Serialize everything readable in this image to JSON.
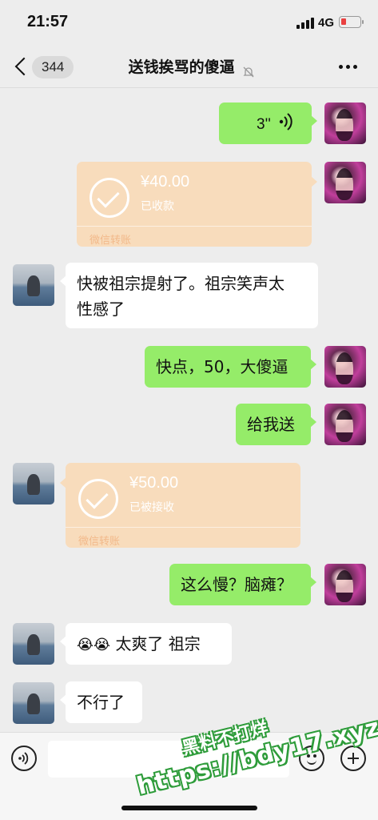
{
  "status_bar": {
    "time": "21:57",
    "network": "4G"
  },
  "nav": {
    "back_badge": "344",
    "title": "送钱挨骂的傻逼"
  },
  "messages": [
    {
      "side": "right",
      "type": "voice",
      "duration": "3''"
    },
    {
      "side": "right",
      "type": "transfer",
      "amount": "¥40.00",
      "status": "已收款",
      "footer": "微信转账"
    },
    {
      "side": "left",
      "type": "text",
      "line1": "快被祖宗提射了。祖宗笑声太",
      "line2": "性感了"
    },
    {
      "side": "right",
      "type": "text",
      "text": "快点，50，大傻逼"
    },
    {
      "side": "right",
      "type": "text",
      "text": "给我送"
    },
    {
      "side": "left",
      "type": "transfer",
      "amount": "¥50.00",
      "status": "已被接收",
      "footer": "微信转账"
    },
    {
      "side": "right",
      "type": "text",
      "text": "这么慢？脑瘫？"
    },
    {
      "side": "left",
      "type": "text",
      "emoji": "😭😭",
      "text": "太爽了 祖宗"
    },
    {
      "side": "left",
      "type": "text",
      "text": "不行了"
    }
  ],
  "watermark": {
    "line1": "黑料不打烊",
    "line2": "https://bdy17.xyz"
  },
  "colors": {
    "bubble_green": "#95ec69",
    "transfer_bg": "#f8dcbc",
    "background": "#ededed"
  }
}
